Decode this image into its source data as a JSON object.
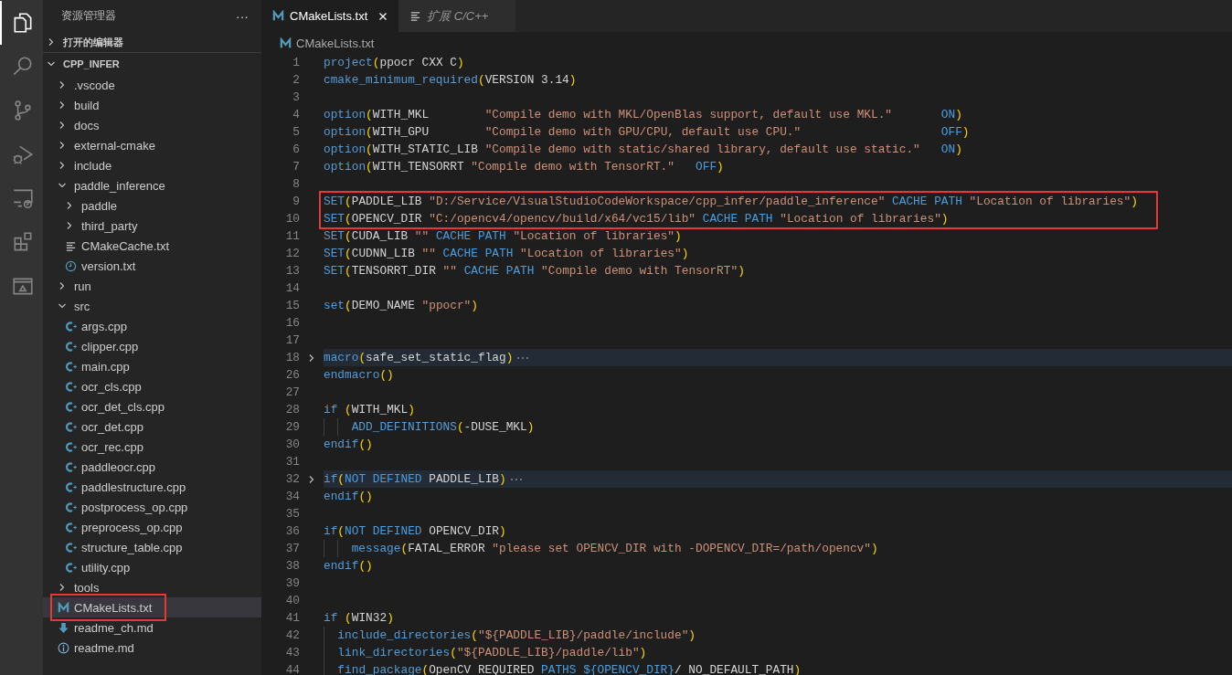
{
  "activity_bar": [
    {
      "kind": "files",
      "selected": true
    },
    {
      "kind": "search",
      "selected": false
    },
    {
      "kind": "source_control",
      "selected": false
    },
    {
      "kind": "run_debug",
      "selected": false
    },
    {
      "kind": "remote",
      "selected": false
    },
    {
      "kind": "extensions",
      "selected": false
    },
    {
      "kind": "panel",
      "selected": false
    }
  ],
  "sidebar": {
    "title": "资源管理器",
    "more": "···",
    "sections": [
      {
        "label": "打开的编辑器",
        "expanded": false
      },
      {
        "label": "CPP_INFER",
        "expanded": true,
        "tree": [
          {
            "label": ".vscode",
            "kind": "folder",
            "expanded": false,
            "selected": false,
            "marked": false
          },
          {
            "label": "build",
            "kind": "folder",
            "expanded": false,
            "selected": false,
            "marked": false
          },
          {
            "label": "docs",
            "kind": "folder",
            "expanded": false,
            "selected": false,
            "marked": false
          },
          {
            "label": "external-cmake",
            "kind": "folder",
            "expanded": false,
            "selected": false,
            "marked": false
          },
          {
            "label": "include",
            "kind": "folder",
            "expanded": false,
            "selected": false,
            "marked": false
          },
          {
            "label": "paddle_inference",
            "kind": "folder",
            "expanded": true,
            "selected": false,
            "marked": false,
            "children": [
              {
                "label": "paddle",
                "kind": "folder",
                "expanded": false,
                "selected": false,
                "marked": false
              },
              {
                "label": "third_party",
                "kind": "folder",
                "expanded": false,
                "selected": false,
                "marked": false
              },
              {
                "label": "CMakeCache.txt",
                "kind": "text",
                "selected": false,
                "marked": false
              },
              {
                "label": "version.txt",
                "kind": "clock",
                "selected": false,
                "marked": false
              }
            ]
          },
          {
            "label": "run",
            "kind": "folder",
            "expanded": false,
            "selected": false,
            "marked": false
          },
          {
            "label": "src",
            "kind": "folder",
            "expanded": true,
            "selected": false,
            "marked": false,
            "children": [
              {
                "label": "args.cpp",
                "kind": "cpp",
                "selected": false,
                "marked": false
              },
              {
                "label": "clipper.cpp",
                "kind": "cpp",
                "selected": false,
                "marked": false
              },
              {
                "label": "main.cpp",
                "kind": "cpp",
                "selected": false,
                "marked": false
              },
              {
                "label": "ocr_cls.cpp",
                "kind": "cpp",
                "selected": false,
                "marked": false
              },
              {
                "label": "ocr_det_cls.cpp",
                "kind": "cpp",
                "selected": false,
                "marked": false
              },
              {
                "label": "ocr_det.cpp",
                "kind": "cpp",
                "selected": false,
                "marked": false
              },
              {
                "label": "ocr_rec.cpp",
                "kind": "cpp",
                "selected": false,
                "marked": false
              },
              {
                "label": "paddleocr.cpp",
                "kind": "cpp",
                "selected": false,
                "marked": false
              },
              {
                "label": "paddlestructure.cpp",
                "kind": "cpp",
                "selected": false,
                "marked": false
              },
              {
                "label": "postprocess_op.cpp",
                "kind": "cpp",
                "selected": false,
                "marked": false
              },
              {
                "label": "preprocess_op.cpp",
                "kind": "cpp",
                "selected": false,
                "marked": false
              },
              {
                "label": "structure_table.cpp",
                "kind": "cpp",
                "selected": false,
                "marked": false
              },
              {
                "label": "utility.cpp",
                "kind": "cpp",
                "selected": false,
                "marked": false
              }
            ]
          },
          {
            "label": "tools",
            "kind": "folder",
            "expanded": false,
            "selected": false,
            "marked": false
          },
          {
            "label": "CMakeLists.txt",
            "kind": "cmake",
            "selected": true,
            "marked": true
          },
          {
            "label": "readme_ch.md",
            "kind": "download",
            "selected": false,
            "marked": false
          },
          {
            "label": "readme.md",
            "kind": "info",
            "selected": false,
            "marked": false
          }
        ]
      }
    ]
  },
  "tabs": [
    {
      "label": "CMakeLists.txt",
      "kind": "cmake",
      "selected": true,
      "preview": false
    },
    {
      "label": "扩展 C/C++",
      "kind": "text",
      "selected": false,
      "preview": true
    }
  ],
  "breadcrumb": {
    "kind": "cmake",
    "label": "CMakeLists.txt"
  },
  "code": [
    {
      "number": "1",
      "folded": false,
      "marked": false,
      "kind": "top",
      "tokens": [
        {
          "kind": "fn",
          "text": "project"
        },
        {
          "kind": "paren",
          "text": "("
        },
        {
          "kind": "plain",
          "text": "ppocr CXX C"
        },
        {
          "kind": "paren",
          "text": ")"
        }
      ]
    },
    {
      "number": "2",
      "folded": false,
      "marked": false,
      "kind": "top",
      "tokens": [
        {
          "kind": "fn",
          "text": "cmake_minimum_required"
        },
        {
          "kind": "paren",
          "text": "("
        },
        {
          "kind": "plain",
          "text": "VERSION 3.14"
        },
        {
          "kind": "paren",
          "text": ")"
        }
      ]
    },
    {
      "number": "3",
      "folded": false,
      "marked": false,
      "kind": "top"
    },
    {
      "number": "4",
      "folded": false,
      "marked": false,
      "kind": "top",
      "tokens": [
        {
          "kind": "fn",
          "text": "option"
        },
        {
          "kind": "paren",
          "text": "("
        },
        {
          "kind": "plain",
          "text": "WITH_MKL        "
        },
        {
          "kind": "str",
          "text": "\"Compile demo with MKL/OpenBlas support, default use MKL.\"       "
        },
        {
          "kind": "kw",
          "text": "ON"
        },
        {
          "kind": "paren",
          "text": ")"
        }
      ]
    },
    {
      "number": "5",
      "folded": false,
      "marked": false,
      "kind": "top",
      "tokens": [
        {
          "kind": "fn",
          "text": "option"
        },
        {
          "kind": "paren",
          "text": "("
        },
        {
          "kind": "plain",
          "text": "WITH_GPU        "
        },
        {
          "kind": "str",
          "text": "\"Compile demo with GPU/CPU, default use CPU.\"                    "
        },
        {
          "kind": "kw",
          "text": "OFF"
        },
        {
          "kind": "paren",
          "text": ")"
        }
      ]
    },
    {
      "number": "6",
      "folded": false,
      "marked": false,
      "kind": "top",
      "tokens": [
        {
          "kind": "fn",
          "text": "option"
        },
        {
          "kind": "paren",
          "text": "("
        },
        {
          "kind": "plain",
          "text": "WITH_STATIC_LIB "
        },
        {
          "kind": "str",
          "text": "\"Compile demo with static/shared library, default use static.\"   "
        },
        {
          "kind": "kw",
          "text": "ON"
        },
        {
          "kind": "paren",
          "text": ")"
        }
      ]
    },
    {
      "number": "7",
      "folded": false,
      "marked": false,
      "kind": "top",
      "tokens": [
        {
          "kind": "fn",
          "text": "option"
        },
        {
          "kind": "paren",
          "text": "("
        },
        {
          "kind": "plain",
          "text": "WITH_TENSORRT "
        },
        {
          "kind": "str",
          "text": "\"Compile demo with TensorRT.\"   "
        },
        {
          "kind": "kw",
          "text": "OFF"
        },
        {
          "kind": "paren",
          "text": ")"
        }
      ]
    },
    {
      "number": "8",
      "folded": false,
      "marked": false,
      "kind": "top"
    },
    {
      "number": "9",
      "folded": false,
      "marked": true,
      "kind": "top",
      "tokens": [
        {
          "kind": "fn",
          "text": "SET"
        },
        {
          "kind": "paren",
          "text": "("
        },
        {
          "kind": "plain",
          "text": "PADDLE_LIB "
        },
        {
          "kind": "str",
          "text": "\"D:/Service/VisualStudioCodeWorkspace/cpp_infer/paddle_inference\" "
        },
        {
          "kind": "kw",
          "text": "CACHE PATH "
        },
        {
          "kind": "str",
          "text": "\"Location of libraries\""
        },
        {
          "kind": "paren",
          "text": ")"
        }
      ]
    },
    {
      "number": "10",
      "folded": false,
      "marked": true,
      "kind": "top",
      "tokens": [
        {
          "kind": "fn",
          "text": "SET"
        },
        {
          "kind": "paren",
          "text": "("
        },
        {
          "kind": "plain",
          "text": "OPENCV_DIR "
        },
        {
          "kind": "str",
          "text": "\"C:/opencv4/opencv/build/x64/vc15/lib\" "
        },
        {
          "kind": "kw",
          "text": "CACHE PATH "
        },
        {
          "kind": "str",
          "text": "\"Location of libraries\""
        },
        {
          "kind": "paren",
          "text": ")"
        }
      ]
    },
    {
      "number": "11",
      "folded": false,
      "marked": false,
      "kind": "top",
      "tokens": [
        {
          "kind": "fn",
          "text": "SET"
        },
        {
          "kind": "paren",
          "text": "("
        },
        {
          "kind": "plain",
          "text": "CUDA_LIB "
        },
        {
          "kind": "str",
          "text": "\"\" "
        },
        {
          "kind": "kw",
          "text": "CACHE PATH "
        },
        {
          "kind": "str",
          "text": "\"Location of libraries\""
        },
        {
          "kind": "paren",
          "text": ")"
        }
      ]
    },
    {
      "number": "12",
      "folded": false,
      "marked": false,
      "kind": "top",
      "tokens": [
        {
          "kind": "fn",
          "text": "SET"
        },
        {
          "kind": "paren",
          "text": "("
        },
        {
          "kind": "plain",
          "text": "CUDNN_LIB "
        },
        {
          "kind": "str",
          "text": "\"\" "
        },
        {
          "kind": "kw",
          "text": "CACHE PATH "
        },
        {
          "kind": "str",
          "text": "\"Location of libraries\""
        },
        {
          "kind": "paren",
          "text": ")"
        }
      ]
    },
    {
      "number": "13",
      "folded": false,
      "marked": false,
      "kind": "top",
      "tokens": [
        {
          "kind": "fn",
          "text": "SET"
        },
        {
          "kind": "paren",
          "text": "("
        },
        {
          "kind": "plain",
          "text": "TENSORRT_DIR "
        },
        {
          "kind": "str",
          "text": "\"\" "
        },
        {
          "kind": "kw",
          "text": "CACHE PATH "
        },
        {
          "kind": "str",
          "text": "\"Compile demo with TensorRT\""
        },
        {
          "kind": "paren",
          "text": ")"
        }
      ]
    },
    {
      "number": "14",
      "folded": false,
      "marked": false,
      "kind": "top"
    },
    {
      "number": "15",
      "folded": false,
      "marked": false,
      "kind": "top",
      "tokens": [
        {
          "kind": "fn",
          "text": "set"
        },
        {
          "kind": "paren",
          "text": "("
        },
        {
          "kind": "plain",
          "text": "DEMO_NAME "
        },
        {
          "kind": "str",
          "text": "\"ppocr\""
        },
        {
          "kind": "paren",
          "text": ")"
        }
      ]
    },
    {
      "number": "16",
      "folded": false,
      "marked": false,
      "kind": "top"
    },
    {
      "number": "17",
      "folded": false,
      "marked": false,
      "kind": "top"
    },
    {
      "number": "18",
      "folded": true,
      "marked": false,
      "kind": "top",
      "tokens": [
        {
          "kind": "fn",
          "text": "macro"
        },
        {
          "kind": "paren",
          "text": "("
        },
        {
          "kind": "plain",
          "text": "safe_set_static_flag"
        },
        {
          "kind": "paren",
          "text": ")"
        }
      ]
    },
    {
      "number": "26",
      "folded": false,
      "marked": false,
      "kind": "top",
      "tokens": [
        {
          "kind": "fn",
          "text": "endmacro"
        },
        {
          "kind": "paren",
          "text": "()"
        }
      ]
    },
    {
      "number": "27",
      "folded": false,
      "marked": false,
      "kind": "top"
    },
    {
      "number": "28",
      "folded": false,
      "marked": false,
      "kind": "top",
      "tokens": [
        {
          "kind": "fn",
          "text": "if "
        },
        {
          "kind": "paren",
          "text": "("
        },
        {
          "kind": "plain",
          "text": "WITH_MKL"
        },
        {
          "kind": "paren",
          "text": ")"
        }
      ]
    },
    {
      "number": "29",
      "folded": false,
      "marked": false,
      "kind": "nested",
      "tokens": [
        {
          "kind": "fn",
          "text": "ADD_DEFINITIONS"
        },
        {
          "kind": "paren",
          "text": "("
        },
        {
          "kind": "plain",
          "text": "-DUSE_MKL"
        },
        {
          "kind": "paren",
          "text": ")"
        }
      ]
    },
    {
      "number": "30",
      "folded": false,
      "marked": false,
      "kind": "top",
      "tokens": [
        {
          "kind": "fn",
          "text": "endif"
        },
        {
          "kind": "paren",
          "text": "()"
        }
      ]
    },
    {
      "number": "31",
      "folded": false,
      "marked": false,
      "kind": "top"
    },
    {
      "number": "32",
      "folded": true,
      "marked": false,
      "kind": "top",
      "tokens": [
        {
          "kind": "fn",
          "text": "if"
        },
        {
          "kind": "paren",
          "text": "("
        },
        {
          "kind": "kw",
          "text": "NOT DEFINED "
        },
        {
          "kind": "plain",
          "text": "PADDLE_LIB"
        },
        {
          "kind": "paren",
          "text": ")"
        }
      ]
    },
    {
      "number": "34",
      "folded": false,
      "marked": false,
      "kind": "top",
      "tokens": [
        {
          "kind": "fn",
          "text": "endif"
        },
        {
          "kind": "paren",
          "text": "()"
        }
      ]
    },
    {
      "number": "35",
      "folded": false,
      "marked": false,
      "kind": "top"
    },
    {
      "number": "36",
      "folded": false,
      "marked": false,
      "kind": "top",
      "tokens": [
        {
          "kind": "fn",
          "text": "if"
        },
        {
          "kind": "paren",
          "text": "("
        },
        {
          "kind": "kw",
          "text": "NOT DEFINED "
        },
        {
          "kind": "plain",
          "text": "OPENCV_DIR"
        },
        {
          "kind": "paren",
          "text": ")"
        }
      ]
    },
    {
      "number": "37",
      "folded": false,
      "marked": false,
      "kind": "nested",
      "tokens": [
        {
          "kind": "fn",
          "text": "message"
        },
        {
          "kind": "paren",
          "text": "("
        },
        {
          "kind": "plain",
          "text": "FATAL_ERROR "
        },
        {
          "kind": "str",
          "text": "\"please set OPENCV_DIR with -DOPENCV_DIR=/path/opencv\""
        },
        {
          "kind": "paren",
          "text": ")"
        }
      ]
    },
    {
      "number": "38",
      "folded": false,
      "marked": false,
      "kind": "top",
      "tokens": [
        {
          "kind": "fn",
          "text": "endif"
        },
        {
          "kind": "paren",
          "text": "()"
        }
      ]
    },
    {
      "number": "39",
      "folded": false,
      "marked": false,
      "kind": "top"
    },
    {
      "number": "40",
      "folded": false,
      "marked": false,
      "kind": "top"
    },
    {
      "number": "41",
      "folded": false,
      "marked": false,
      "kind": "top",
      "tokens": [
        {
          "kind": "fn",
          "text": "if "
        },
        {
          "kind": "paren",
          "text": "("
        },
        {
          "kind": "plain",
          "text": "WIN32"
        },
        {
          "kind": "paren",
          "text": ")"
        }
      ]
    },
    {
      "number": "42",
      "folded": false,
      "marked": false,
      "kind": "inner",
      "tokens": [
        {
          "kind": "fn",
          "text": "include_directories"
        },
        {
          "kind": "paren",
          "text": "("
        },
        {
          "kind": "str",
          "text": "\"${PADDLE_LIB}/paddle/include\""
        },
        {
          "kind": "paren",
          "text": ")"
        }
      ]
    },
    {
      "number": "43",
      "folded": false,
      "marked": false,
      "kind": "inner",
      "tokens": [
        {
          "kind": "fn",
          "text": "link_directories"
        },
        {
          "kind": "paren",
          "text": "("
        },
        {
          "kind": "str",
          "text": "\"${PADDLE_LIB}/paddle/lib\""
        },
        {
          "kind": "paren",
          "text": ")"
        }
      ]
    },
    {
      "number": "44",
      "folded": false,
      "marked": false,
      "kind": "inner",
      "tokens": [
        {
          "kind": "fn",
          "text": "find_package"
        },
        {
          "kind": "paren",
          "text": "("
        },
        {
          "kind": "plain",
          "text": "OpenCV REQUIRED "
        },
        {
          "kind": "kw",
          "text": "PATHS ${OPENCV_DIR}"
        },
        {
          "kind": "plain",
          "text": "/ NO_DEFAULT_PATH"
        },
        {
          "kind": "paren",
          "text": ")"
        }
      ]
    }
  ]
}
